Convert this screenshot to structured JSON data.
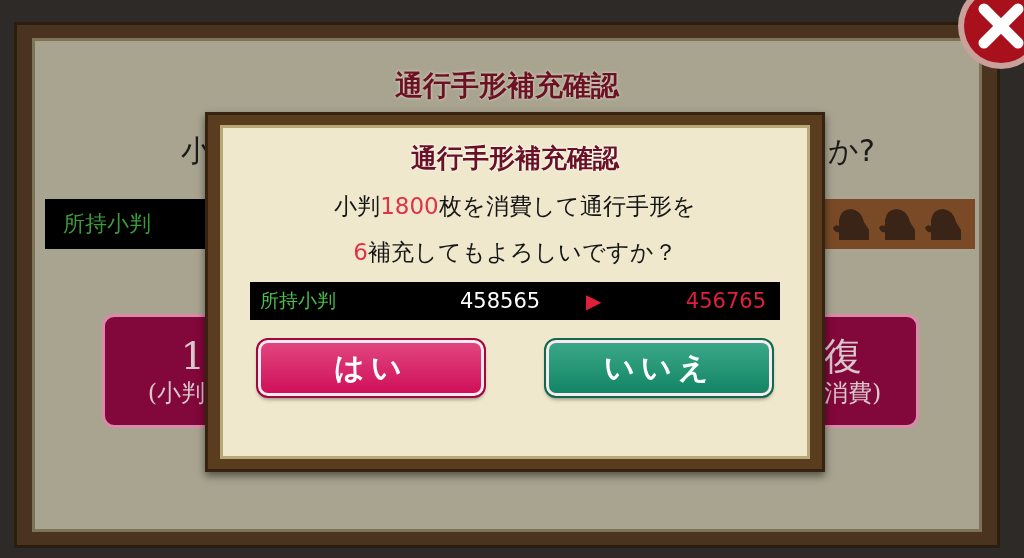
{
  "background_panel": {
    "title": "通行手形補充確認",
    "question_start": "小",
    "question_end": "か?",
    "coin_label": "所持小判",
    "left_button": {
      "label": "1",
      "sublabel": "(小判"
    },
    "right_button": {
      "label": "復",
      "sublabel": "消費)"
    }
  },
  "dialog": {
    "title": "通行手形補充確認",
    "message_lines": [
      [
        {
          "text": "小判",
          "highlight": false
        },
        {
          "text": "1800",
          "highlight": true
        },
        {
          "text": "枚を消費して通行手形を",
          "highlight": false
        }
      ],
      [
        {
          "text": "6",
          "highlight": true
        },
        {
          "text": "補充してもよろしいですか？",
          "highlight": false
        }
      ]
    ],
    "balance": {
      "label": "所持小判",
      "current": "458565",
      "arrow": "▶",
      "after": "456765"
    },
    "buttons": [
      {
        "label": "はい",
        "kind": "confirm"
      },
      {
        "label": "いいえ",
        "kind": "cancel"
      }
    ]
  }
}
